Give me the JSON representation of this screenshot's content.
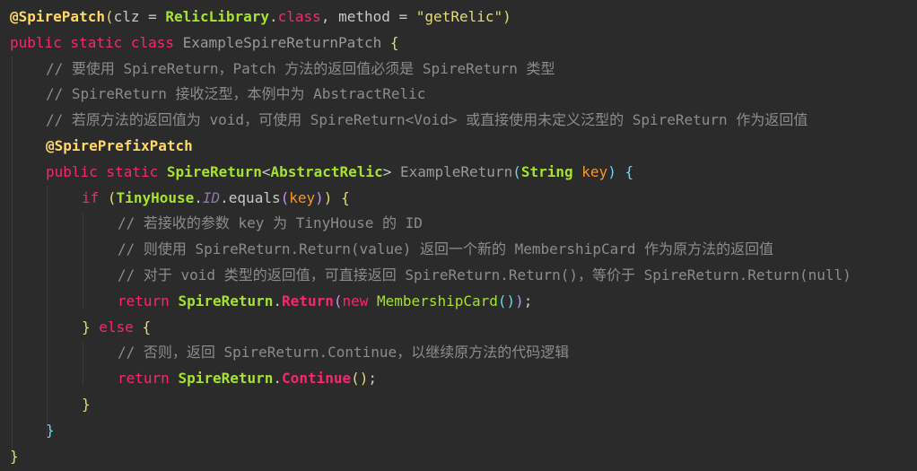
{
  "editor": {
    "lines": [
      {
        "indent": 0,
        "tokens": [
          {
            "t": "@SpirePatch",
            "c": "t-bann"
          },
          {
            "t": "(",
            "c": "t-br1"
          },
          {
            "t": "clz = ",
            "c": "t-plain"
          },
          {
            "t": "RelicLibrary",
            "c": "t-type"
          },
          {
            "t": ".",
            "c": "t-plain"
          },
          {
            "t": "class",
            "c": "t-kw"
          },
          {
            "t": ", method = ",
            "c": "t-plain"
          },
          {
            "t": "\"getRelic\"",
            "c": "t-str"
          },
          {
            "t": ")",
            "c": "t-br1"
          }
        ]
      },
      {
        "indent": 0,
        "tokens": [
          {
            "t": "public static class ",
            "c": "t-kw"
          },
          {
            "t": "ExampleSpireReturnPatch",
            "c": "t-method"
          },
          {
            "t": " ",
            "c": "t-plain"
          },
          {
            "t": "{",
            "c": "t-br1"
          }
        ]
      },
      {
        "indent": 1,
        "tokens": [
          {
            "t": "// 要使用 SpireReturn，Patch 方法的返回值必须是 SpireReturn 类型",
            "c": "t-cmt"
          }
        ]
      },
      {
        "indent": 1,
        "tokens": [
          {
            "t": "// SpireReturn 接收泛型，本例中为 AbstractRelic",
            "c": "t-cmt"
          }
        ]
      },
      {
        "indent": 1,
        "tokens": [
          {
            "t": "// 若原方法的返回值为 void，可使用 SpireReturn<Void> 或直接使用未定义泛型的 SpireReturn 作为返回值",
            "c": "t-cmt"
          }
        ]
      },
      {
        "indent": 1,
        "tokens": [
          {
            "t": "@SpirePrefixPatch",
            "c": "t-bann"
          }
        ]
      },
      {
        "indent": 1,
        "tokens": [
          {
            "t": "public static ",
            "c": "t-kw"
          },
          {
            "t": "SpireReturn",
            "c": "t-type"
          },
          {
            "t": "<",
            "c": "t-punc"
          },
          {
            "t": "AbstractRelic",
            "c": "t-type"
          },
          {
            "t": "> ",
            "c": "t-punc"
          },
          {
            "t": "ExampleReturn",
            "c": "t-method"
          },
          {
            "t": "(",
            "c": "t-br2"
          },
          {
            "t": "String",
            "c": "t-type"
          },
          {
            "t": " ",
            "c": "t-plain"
          },
          {
            "t": "key",
            "c": "t-param"
          },
          {
            "t": ")",
            "c": "t-br2"
          },
          {
            "t": " ",
            "c": "t-plain"
          },
          {
            "t": "{",
            "c": "t-br2"
          }
        ]
      },
      {
        "indent": 2,
        "tokens": [
          {
            "t": "if",
            "c": "t-kw"
          },
          {
            "t": " ",
            "c": "t-plain"
          },
          {
            "t": "(",
            "c": "t-br1"
          },
          {
            "t": "TinyHouse",
            "c": "t-type"
          },
          {
            "t": ".",
            "c": "t-plain"
          },
          {
            "t": "ID",
            "c": "t-fld"
          },
          {
            "t": ".equals",
            "c": "t-plain"
          },
          {
            "t": "(",
            "c": "t-br3"
          },
          {
            "t": "key",
            "c": "t-param"
          },
          {
            "t": ")",
            "c": "t-br3"
          },
          {
            "t": ")",
            "c": "t-br1"
          },
          {
            "t": " ",
            "c": "t-plain"
          },
          {
            "t": "{",
            "c": "t-br1"
          }
        ]
      },
      {
        "indent": 3,
        "tokens": [
          {
            "t": "// 若接收的参数 key 为 TinyHouse 的 ID",
            "c": "t-cmt"
          }
        ]
      },
      {
        "indent": 3,
        "tokens": [
          {
            "t": "// 则使用 SpireReturn.Return(value) 返回一个新的 MembershipCard 作为原方法的返回值",
            "c": "t-cmt"
          }
        ]
      },
      {
        "indent": 3,
        "tokens": [
          {
            "t": "// 对于 void 类型的返回值，可直接返回 SpireReturn.Return()，等价于 SpireReturn.Return(null)",
            "c": "t-cmt"
          }
        ]
      },
      {
        "indent": 3,
        "tokens": [
          {
            "t": "return ",
            "c": "t-kw"
          },
          {
            "t": "SpireReturn",
            "c": "t-type"
          },
          {
            "t": ".",
            "c": "t-plain"
          },
          {
            "t": "Return",
            "c": "t-call"
          },
          {
            "t": "(",
            "c": "t-br3"
          },
          {
            "t": "new ",
            "c": "t-kw"
          },
          {
            "t": "MembershipCard",
            "c": "t-typen"
          },
          {
            "t": "()",
            "c": "t-br2"
          },
          {
            "t": ")",
            "c": "t-br3"
          },
          {
            "t": ";",
            "c": "t-plain"
          }
        ]
      },
      {
        "indent": 2,
        "tokens": [
          {
            "t": "}",
            "c": "t-br1"
          },
          {
            "t": " else ",
            "c": "t-kw"
          },
          {
            "t": "{",
            "c": "t-br1"
          }
        ]
      },
      {
        "indent": 3,
        "tokens": [
          {
            "t": "// 否则，返回 SpireReturn.Continue，以继续原方法的代码逻辑",
            "c": "t-cmt"
          }
        ]
      },
      {
        "indent": 3,
        "tokens": [
          {
            "t": "return ",
            "c": "t-kw"
          },
          {
            "t": "SpireReturn",
            "c": "t-type"
          },
          {
            "t": ".",
            "c": "t-plain"
          },
          {
            "t": "Continue",
            "c": "t-call"
          },
          {
            "t": "()",
            "c": "t-br1"
          },
          {
            "t": ";",
            "c": "t-plain"
          }
        ]
      },
      {
        "indent": 2,
        "tokens": [
          {
            "t": "}",
            "c": "t-br1"
          }
        ]
      },
      {
        "indent": 1,
        "tokens": [
          {
            "t": "}",
            "c": "t-br2"
          }
        ]
      },
      {
        "indent": 0,
        "tokens": [
          {
            "t": "}",
            "c": "t-br1"
          }
        ]
      }
    ]
  }
}
